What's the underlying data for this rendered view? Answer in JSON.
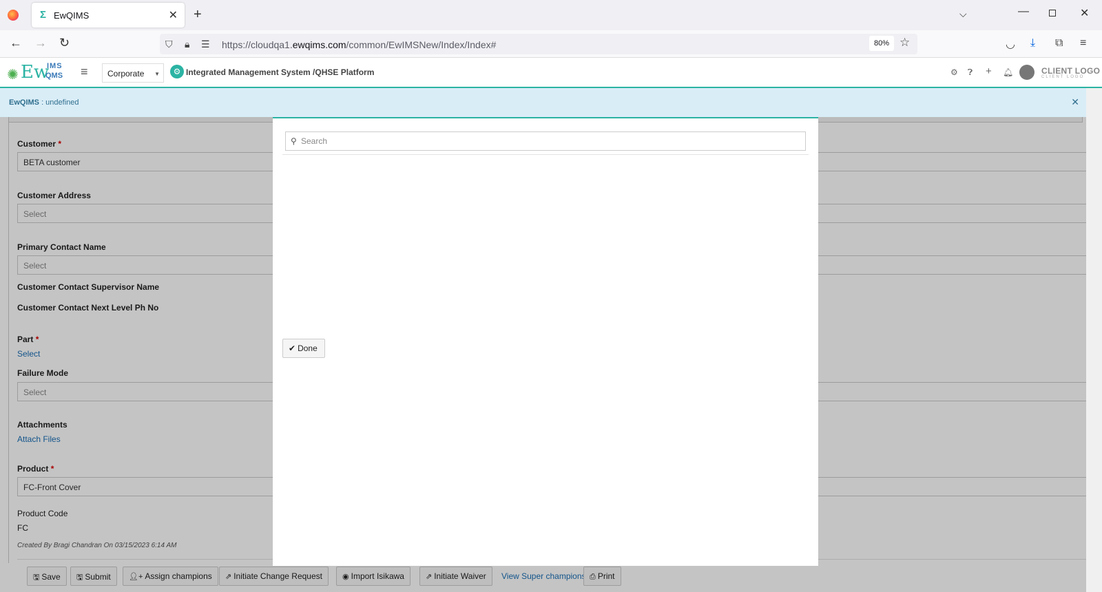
{
  "browser": {
    "tab_title": "EwQIMS",
    "tab_favicon": "Σ",
    "url_prefix": "https://cloudqa1.",
    "url_domain": "ewqims.com",
    "url_path": "/common/EwIMSNew/Index/Index#",
    "zoom": "80%"
  },
  "app": {
    "logo_ew": "Ew",
    "logo_ims": "IMS",
    "logo_qms": "QMS",
    "corporate_select": "Corporate",
    "platform_title": "Integrated Management System /QHSE Platform",
    "client_logo": "CLIENT LOGO",
    "client_logo_sub": "CLIENT LOGO"
  },
  "alert": {
    "app_name": "EwQIMS",
    "message": " : undefined"
  },
  "form": {
    "customer_label": "Customer",
    "customer_value": "BETA customer",
    "customer_address_label": "Customer Address",
    "customer_address_placeholder": "Select",
    "primary_contact_label": "Primary Contact Name",
    "primary_contact_placeholder": "Select",
    "supervisor_label": "Customer Contact Supervisor Name",
    "next_level_label": "Customer Contact Next Level Ph No",
    "part_label": "Part",
    "part_link": "Select",
    "failure_mode_label": "Failure Mode",
    "failure_mode_placeholder": "Select",
    "attachments_label": "Attachments",
    "attach_link": "Attach Files",
    "product_label": "Product",
    "product_value": "FC-Front Cover",
    "product_code_label": "Product Code",
    "product_code_value": "FC",
    "created_by": "Created By Bragi Chandran On 03/15/2023 6:14 AM",
    "required_mark": "*"
  },
  "toolbar": {
    "save": "Save",
    "submit": "Submit",
    "assign_champions": "Assign champions",
    "initiate_change_request": "Initiate Change Request",
    "import_isikawa": "Import Isikawa",
    "initiate_waiver": "Initiate Waiver",
    "view_super_champions": "View Super champions",
    "print": "Print"
  },
  "modal": {
    "search_placeholder": "Search",
    "done": "Done"
  },
  "colors": {
    "accent": "#2bb3a3",
    "alert_bg": "#d9edf7",
    "link": "#1a6fb5"
  }
}
